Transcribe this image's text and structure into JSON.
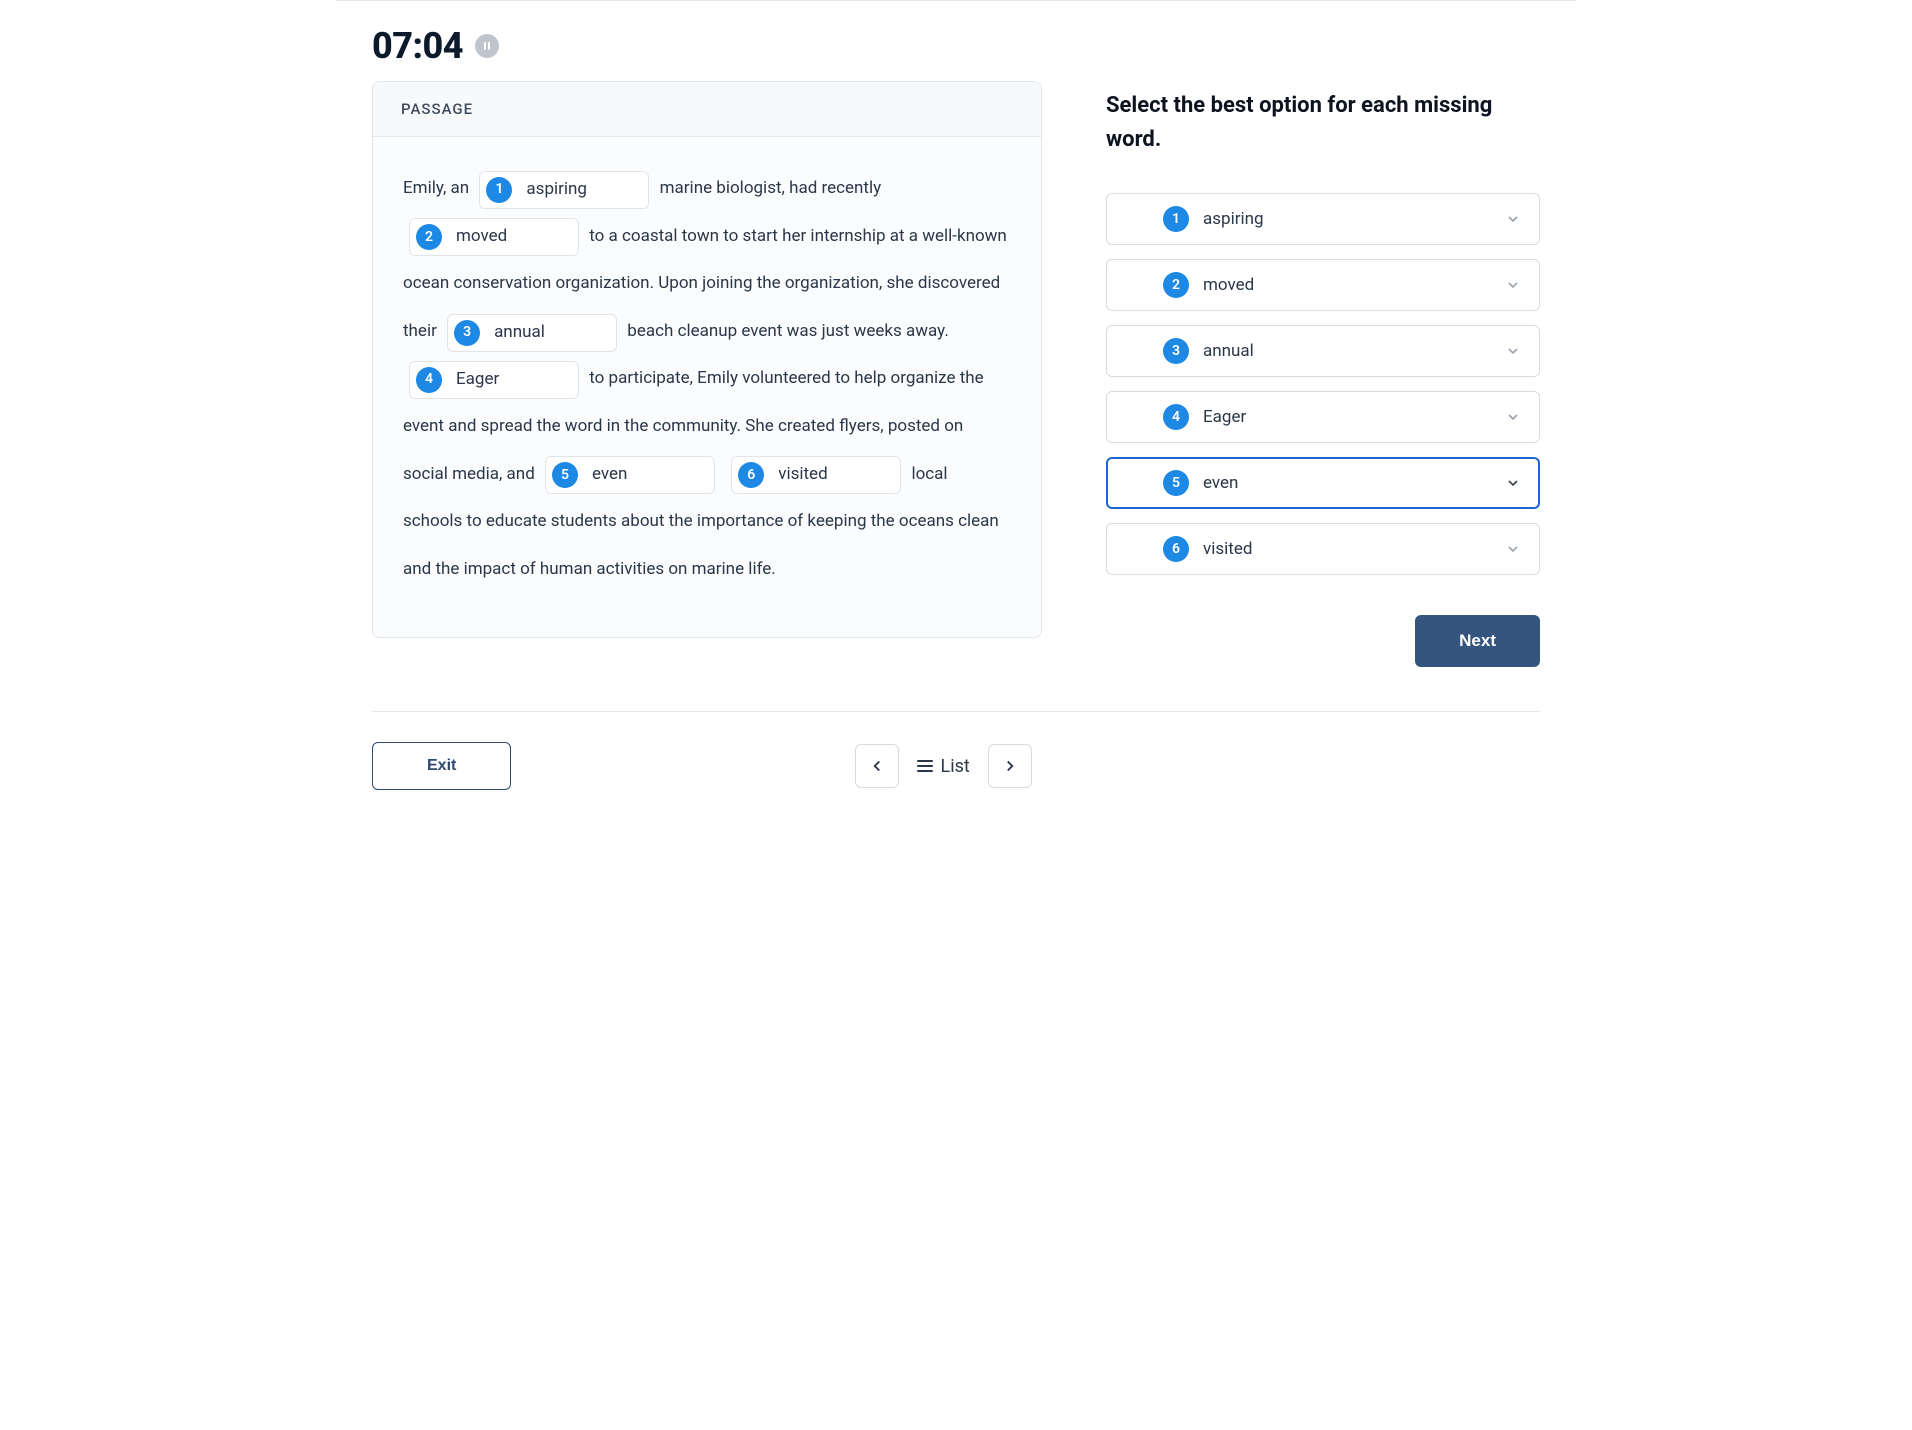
{
  "timer": "07:04",
  "passage_label": "PASSAGE",
  "passage": {
    "segments": [
      "Emily, an ",
      " marine biologist, had recently ",
      " to a coastal town to start her internship at a well-known ocean conservation organization. Upon joining the organization, she discovered their ",
      " beach cleanup event was just weeks away. ",
      " to participate, Emily volunteered to help organize the event and spread the word in the community. She created flyers, posted on social media, and ",
      " ",
      " local schools to educate students about the importance of keeping the oceans clean and the impact of human activities on marine life."
    ],
    "blanks": [
      {
        "num": "1",
        "word": "aspiring"
      },
      {
        "num": "2",
        "word": "moved"
      },
      {
        "num": "3",
        "word": "annual"
      },
      {
        "num": "4",
        "word": "Eager"
      },
      {
        "num": "5",
        "word": "even"
      },
      {
        "num": "6",
        "word": "visited"
      }
    ]
  },
  "instruction": "Select the best option for each missing word.",
  "options": [
    {
      "num": "1",
      "word": "aspiring",
      "active": false
    },
    {
      "num": "2",
      "word": "moved",
      "active": false
    },
    {
      "num": "3",
      "word": "annual",
      "active": false
    },
    {
      "num": "4",
      "word": "Eager",
      "active": false
    },
    {
      "num": "5",
      "word": "even",
      "active": true
    },
    {
      "num": "6",
      "word": "visited",
      "active": false
    }
  ],
  "buttons": {
    "next": "Next",
    "exit": "Exit",
    "list": "List"
  }
}
